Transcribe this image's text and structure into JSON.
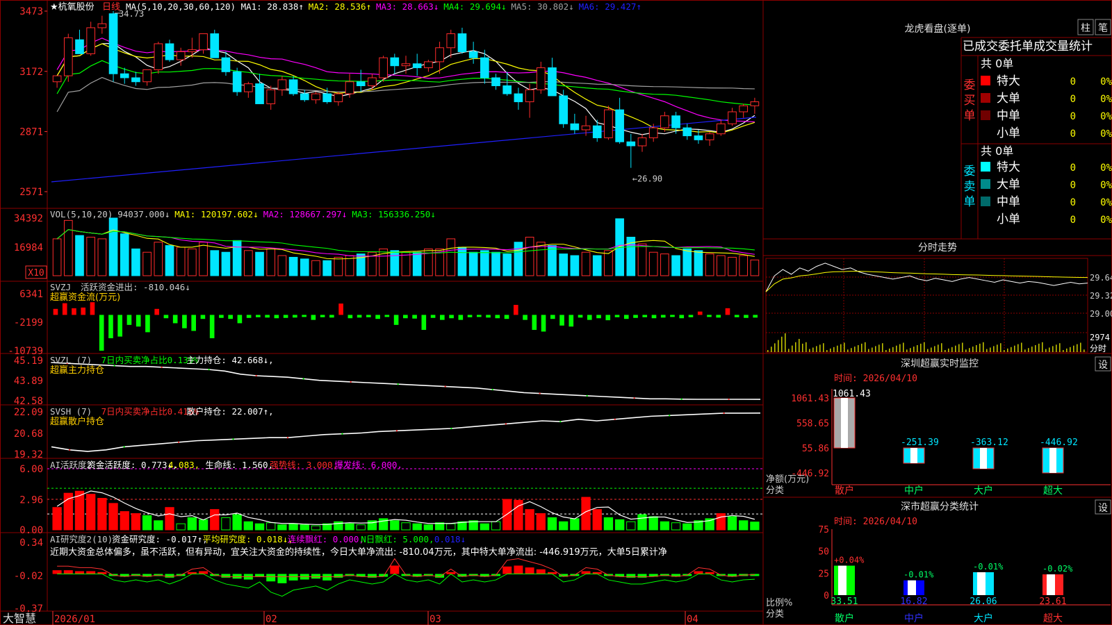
{
  "stock": {
    "title": "★杭氧股份",
    "period": "日线"
  },
  "colors": {
    "up": "#ff2b2b",
    "down": "#00e5ff",
    "grid": "#8b0000",
    "ma1": "#ffffff",
    "ma2": "#ffff00",
    "ma3": "#ff00ff",
    "ma4": "#00ff00",
    "ma5": "#a0a0a0",
    "ma6": "#2020ff"
  },
  "price_panel": {
    "legend": [
      {
        "text": "MA(5,10,20,30,60,120)",
        "color": "#ffffff"
      },
      {
        "text": "MA1: 28.838↑",
        "color": "#ffffff"
      },
      {
        "text": "MA2: 28.536↑",
        "color": "#ffff00"
      },
      {
        "text": "MA3: 28.663↓",
        "color": "#ff00ff"
      },
      {
        "text": "MA4: 29.694↓",
        "color": "#00ff00"
      },
      {
        "text": "MA5: 30.802↓",
        "color": "#a0a0a0"
      },
      {
        "text": "MA6: 29.427↑",
        "color": "#2020ff"
      }
    ],
    "y_ticks": [
      "3473",
      "3172",
      "2871",
      "2571"
    ],
    "high_label": "34.73",
    "low_label": "26.90"
  },
  "volume_panel": {
    "legend": [
      {
        "text": "VOL(5,10,20)",
        "color": "#cccccc"
      },
      {
        "text": "94037.000↓",
        "color": "#cccccc"
      },
      {
        "text": "MA1: 120197.602↓",
        "color": "#ffff00"
      },
      {
        "text": "MA2: 128667.297↓",
        "color": "#ff00ff"
      },
      {
        "text": "MA3: 156336.250↓",
        "color": "#00ff00"
      }
    ],
    "y_ticks": [
      "34392",
      "16984"
    ],
    "unit": "X10"
  },
  "svzj_panel": {
    "legend": [
      {
        "text": "SVZJ",
        "color": "#cccccc"
      },
      {
        "text": "活跃资金进出: -810.046↓",
        "color": "#cccccc"
      }
    ],
    "subtitle": "超赢资金流(万元)",
    "y_ticks": [
      "6341",
      "-2199",
      "-10739"
    ]
  },
  "svzl_panel": {
    "legend": [
      {
        "text": "SVZL (7)",
        "color": "#cccccc"
      },
      {
        "text": "7日内买卖净占比0.139%",
        "color": "#00ff00"
      },
      {
        "text": "主力持仓: 42.668↓,",
        "color": "#ffffff"
      }
    ],
    "subtitle": "超赢主力持仓",
    "y_ticks": [
      "45.19",
      "43.89",
      "42.58"
    ]
  },
  "svsh_panel": {
    "legend": [
      {
        "text": "SVSH (7)",
        "color": "#cccccc"
      },
      {
        "text": "7日内买卖净占比0.415%",
        "color": "#ff2b2b"
      },
      {
        "text": "散户持仓: 22.007↑,",
        "color": "#ffffff"
      }
    ],
    "subtitle": "超赢散户持仓",
    "y_ticks": [
      "22.09",
      "20.68",
      "19.32"
    ]
  },
  "ai_active_panel": {
    "legend": [
      {
        "text": "AI活跃度2",
        "color": "#cccccc"
      },
      {
        "text": "资金活跃度: 0.773↓,",
        "color": "#ffffff"
      },
      {
        "text": "4.083,",
        "color": "#ffff00"
      },
      {
        "text": "生命线: 1.560,",
        "color": "#ffffff"
      },
      {
        "text": "强势线: 3.000,",
        "color": "#ff2b2b"
      },
      {
        "text": "爆发线: 6.000,",
        "color": "#ff00ff"
      }
    ],
    "y_ticks": [
      "6.00",
      "2.96",
      "0.00"
    ]
  },
  "ai_research_panel": {
    "legend": [
      {
        "text": "AI研究度2(10)",
        "color": "#cccccc"
      },
      {
        "text": "资金研究度: -0.017↑,",
        "color": "#ffffff"
      },
      {
        "text": "平均研究度: 0.018↓,",
        "color": "#ffff00"
      },
      {
        "text": "连续飘红: 0.000,",
        "color": "#ff00ff"
      },
      {
        "text": "N日飘红: 5.000,",
        "color": "#00ff00"
      },
      {
        "text": "0.018↓",
        "color": "#2020ff"
      }
    ],
    "commentary": "近期大资金总体偏多，虽不活跃，但有异动，宜关注大资金的持续性，今日大单净流出: -810.04万元，其中特大单净流出: -446.919万元，大单5日累计净",
    "y_ticks": [
      "0.34",
      "-0.02",
      "-0.37"
    ]
  },
  "x_axis": {
    "brand": "大智慧",
    "labels": [
      "2026/01",
      "02",
      "03",
      "04"
    ]
  },
  "longhu": {
    "title": "龙虎看盘(逐单)",
    "btn_bar": "柱",
    "btn_pen": "笔",
    "header": "已成交委托单成交量统计",
    "buy_label": "委买单",
    "sell_label": "委卖单",
    "buy_total": "共 0单",
    "sell_total": "共 0单",
    "buy_rows": [
      {
        "name": "特大",
        "count": "0",
        "pct": "0%",
        "color": "#ff0000"
      },
      {
        "name": "大单",
        "count": "0",
        "pct": "0%",
        "color": "#a00000"
      },
      {
        "name": "中单",
        "count": "0",
        "pct": "0%",
        "color": "#700000"
      },
      {
        "name": "小单",
        "count": "0",
        "pct": "0%",
        "color": "#000000"
      }
    ],
    "sell_rows": [
      {
        "name": "特大",
        "count": "0",
        "pct": "0%",
        "color": "#00ffff"
      },
      {
        "name": "大单",
        "count": "0",
        "pct": "0%",
        "color": "#008b8b"
      },
      {
        "name": "中单",
        "count": "0",
        "pct": "0%",
        "color": "#006b6b"
      },
      {
        "name": "小单",
        "count": "0",
        "pct": "0%",
        "color": "#000000"
      }
    ]
  },
  "intraday": {
    "title": "分时走势",
    "y_ticks": [
      "29.64",
      "29.32",
      "29.00"
    ],
    "vol_label": "2974",
    "unit": "分时"
  },
  "monitor": {
    "title": "深圳超赢实时监控",
    "btn": "设",
    "time": "时间: 2026/04/10",
    "ylabel": "净额(万元)",
    "xlabel": "分类",
    "y_ticks": [
      "1061.43",
      "558.65",
      "55.86",
      "-446.92"
    ]
  },
  "classify": {
    "title": "深市超赢分类统计",
    "btn": "设",
    "time": "时间: 2026/04/10",
    "ylabel": "比例%",
    "xlabel": "分类",
    "y_ticks": [
      "75",
      "50",
      "25",
      "0"
    ]
  },
  "chart_data": [
    {
      "type": "candlestick",
      "title": "杭氧股份 日线",
      "ylim": [
        25.71,
        34.73
      ],
      "x": [
        "2026/01",
        "02",
        "03",
        "04"
      ],
      "ohlc": [
        [
          31.2,
          31.5,
          30.9,
          31.5
        ],
        [
          31.5,
          33.6,
          31.2,
          33.4
        ],
        [
          33.3,
          33.8,
          32.9,
          32.6
        ],
        [
          32.6,
          34.2,
          32.5,
          33.9
        ],
        [
          33.9,
          34.5,
          33.6,
          34.1
        ],
        [
          34.6,
          34.73,
          31.2,
          31.6
        ],
        [
          31.6,
          31.9,
          31.1,
          31.4
        ],
        [
          31.4,
          31.7,
          31.0,
          31.2
        ],
        [
          31.2,
          31.8,
          31.0,
          31.8
        ],
        [
          31.8,
          33.2,
          31.6,
          33.1
        ],
        [
          33.1,
          33.3,
          32.2,
          32.3
        ],
        [
          32.3,
          32.9,
          32.0,
          32.7
        ],
        [
          32.7,
          33.4,
          32.4,
          32.8
        ],
        [
          32.8,
          33.6,
          32.6,
          33.6
        ],
        [
          33.6,
          33.8,
          32.5,
          32.4
        ],
        [
          32.4,
          32.7,
          31.5,
          31.7
        ],
        [
          31.7,
          31.9,
          30.5,
          30.7
        ],
        [
          30.7,
          31.2,
          30.4,
          31.1
        ],
        [
          31.1,
          31.6,
          30.1,
          30.1
        ],
        [
          30.1,
          31.0,
          29.8,
          30.8
        ],
        [
          30.8,
          31.5,
          30.5,
          31.3
        ],
        [
          31.3,
          31.5,
          30.5,
          30.6
        ],
        [
          30.6,
          30.8,
          30.2,
          30.3
        ],
        [
          30.3,
          30.7,
          30.1,
          30.6
        ],
        [
          30.6,
          30.9,
          30.1,
          30.2
        ],
        [
          30.2,
          30.7,
          30.0,
          30.6
        ],
        [
          30.6,
          31.6,
          30.4,
          31.2
        ],
        [
          31.2,
          31.8,
          30.7,
          31.0
        ],
        [
          31.0,
          31.6,
          30.8,
          31.4
        ],
        [
          31.4,
          32.5,
          31.2,
          32.4
        ],
        [
          32.4,
          32.6,
          31.6,
          32.0
        ],
        [
          32.0,
          32.5,
          31.6,
          32.1
        ],
        [
          32.1,
          32.6,
          31.5,
          31.9
        ],
        [
          31.9,
          32.3,
          31.7,
          32.2
        ],
        [
          32.2,
          33.2,
          31.6,
          32.9
        ],
        [
          32.9,
          33.8,
          32.4,
          33.6
        ],
        [
          33.6,
          33.9,
          32.6,
          32.7
        ],
        [
          32.7,
          33.2,
          32.1,
          32.4
        ],
        [
          32.4,
          32.8,
          31.1,
          31.4
        ],
        [
          31.4,
          31.6,
          30.8,
          31.0
        ],
        [
          31.0,
          31.7,
          30.5,
          30.6
        ],
        [
          30.6,
          30.9,
          29.8,
          30.2
        ],
        [
          30.2,
          31.1,
          29.4,
          30.8
        ],
        [
          30.8,
          32.2,
          30.6,
          31.9
        ],
        [
          31.9,
          32.4,
          30.5,
          30.5
        ],
        [
          30.5,
          30.8,
          28.9,
          29.1
        ],
        [
          29.1,
          29.6,
          28.6,
          28.8
        ],
        [
          28.8,
          29.5,
          28.5,
          29.0
        ],
        [
          29.0,
          29.3,
          28.2,
          28.4
        ],
        [
          28.4,
          30.0,
          28.3,
          29.8
        ],
        [
          29.8,
          30.4,
          28.1,
          28.2
        ],
        [
          28.2,
          28.6,
          26.9,
          28.0
        ],
        [
          28.0,
          28.6,
          27.7,
          28.4
        ],
        [
          28.4,
          29.1,
          28.2,
          28.9
        ],
        [
          28.9,
          29.7,
          28.7,
          29.5
        ],
        [
          29.5,
          29.7,
          28.6,
          28.9
        ],
        [
          28.9,
          29.1,
          28.3,
          28.5
        ],
        [
          28.5,
          28.8,
          28.1,
          28.3
        ],
        [
          28.3,
          28.7,
          28.0,
          28.6
        ],
        [
          28.6,
          29.3,
          28.5,
          29.1
        ],
        [
          29.1,
          29.9,
          29.0,
          29.7
        ],
        [
          29.7,
          30.1,
          29.4,
          30.0
        ],
        [
          30.0,
          30.4,
          29.6,
          30.2
        ]
      ]
    },
    {
      "type": "bar",
      "title": "VOL(5,10,20)",
      "ylim": [
        0,
        34392
      ],
      "values": [
        22000,
        33000,
        24000,
        23000,
        22000,
        34392,
        25000,
        16000,
        14000,
        20000,
        18000,
        17000,
        16000,
        20000,
        15000,
        14000,
        21000,
        15000,
        14000,
        16000,
        12000,
        11000,
        10000,
        9000,
        9000,
        11000,
        12000,
        13000,
        14000,
        16000,
        15000,
        14000,
        14000,
        16000,
        16000,
        22000,
        17000,
        14000,
        15000,
        14000,
        13000,
        20000,
        23000,
        20000,
        18000,
        13000,
        12000,
        14000,
        12000,
        15000,
        34000,
        23000,
        19000,
        14000,
        13000,
        12000,
        16000,
        15000,
        13000,
        12000,
        11000,
        12000,
        9403
      ]
    },
    {
      "type": "bar",
      "title": "超赢资金流(万元)",
      "ylim": [
        -10739,
        6341
      ],
      "values": [
        1800,
        3500,
        2000,
        2200,
        3800,
        -10739,
        -7000,
        -6500,
        -3000,
        -3500,
        -5200,
        1800,
        -1000,
        -2500,
        -4000,
        -4800,
        -1200,
        -7000,
        -900,
        -1200,
        -2500,
        -900,
        -700,
        -800,
        -1000,
        -900,
        -800,
        -600,
        -1500,
        -700,
        -800,
        3400,
        -1000,
        -800,
        -700,
        -1200,
        -600,
        -3000,
        -1000,
        -1100,
        -4500,
        -900,
        -1500,
        -1000,
        -1500,
        -700,
        -500,
        -800,
        -1000,
        -1200,
        3000,
        -1500,
        -4500,
        -5000,
        -1200,
        -3200,
        -3500,
        -800,
        -1500,
        -1000,
        -1600,
        -700,
        -1200,
        -900,
        -700,
        -1000,
        -800,
        -600,
        -1000,
        -700,
        1000,
        -600,
        -800,
        2000,
        -700,
        -900,
        -810
      ]
    },
    {
      "type": "line",
      "title": "超赢主力持仓",
      "ylim": [
        42.58,
        45.19
      ],
      "values": [
        45.05,
        45.0,
        44.95,
        44.9,
        44.85,
        44.8,
        44.8,
        44.75,
        44.7,
        44.65,
        44.6,
        44.5,
        44.3,
        44.2,
        44.15,
        44.1,
        44.0,
        43.9,
        43.85,
        43.8,
        43.75,
        43.7,
        43.65,
        43.6,
        43.55,
        43.5,
        43.45,
        43.4,
        43.3,
        43.2,
        43.1,
        43.05,
        43.0,
        42.95,
        42.9,
        42.85,
        42.8,
        42.75,
        42.7,
        42.7,
        42.68,
        42.67,
        42.67,
        42.67,
        42.67,
        42.668
      ]
    },
    {
      "type": "line",
      "title": "超赢散户持仓",
      "ylim": [
        19.32,
        22.09
      ],
      "values": [
        19.8,
        19.6,
        19.5,
        19.6,
        19.8,
        19.9,
        20.0,
        20.1,
        20.2,
        20.25,
        20.3,
        20.35,
        20.4,
        20.4,
        20.5,
        20.6,
        20.65,
        20.7,
        20.8,
        20.85,
        20.9,
        20.95,
        21.0,
        21.1,
        21.2,
        21.3,
        21.4,
        21.5,
        21.45,
        21.6,
        21.5,
        21.6,
        21.7,
        21.8,
        21.85,
        21.9,
        21.95,
        22.0,
        22.0,
        22.007
      ]
    },
    {
      "type": "bar",
      "title": "AI活跃度2",
      "ylim": [
        0,
        6.0
      ],
      "values": [
        2.2,
        3.6,
        3.8,
        3.5,
        3.1,
        2.6,
        1.8,
        1.6,
        1.4,
        0.9,
        2.2,
        0.6,
        1.2,
        1.0,
        2.0,
        1.2,
        1.5,
        0.8,
        0.6,
        0.7,
        0.5,
        0.6,
        0.5,
        0.4,
        0.6,
        0.8,
        0.6,
        0.5,
        0.9,
        1.1,
        0.9,
        0.7,
        0.6,
        0.5,
        0.7,
        0.6,
        0.8,
        0.9,
        0.6,
        0.8,
        3.0,
        2.9,
        2.0,
        1.6,
        1.2,
        0.8,
        1.1,
        3.2,
        2.0,
        1.2,
        1.0,
        0.8,
        1.5,
        1.3,
        0.8,
        0.7,
        0.6,
        0.9,
        1.1,
        1.6,
        1.3,
        0.9,
        0.773
      ]
    },
    {
      "type": "bar",
      "title": "AI研究度2(10)",
      "ylim": [
        -0.37,
        0.34
      ],
      "values": [
        0.04,
        0.04,
        0.03,
        0.03,
        0.02,
        -0.02,
        -0.03,
        -0.02,
        -0.03,
        -0.02,
        -0.04,
        -0.02,
        0.02,
        0.03,
        -0.02,
        -0.04,
        -0.05,
        -0.06,
        -0.03,
        -0.08,
        -0.1,
        -0.07,
        -0.06,
        -0.05,
        -0.07,
        -0.04,
        -0.02,
        -0.03,
        -0.04,
        -0.03,
        0.09,
        -0.02,
        -0.03,
        -0.02,
        -0.04,
        0.02,
        -0.03,
        -0.02,
        -0.03,
        -0.02,
        0.08,
        0.09,
        0.07,
        0.05,
        0.02,
        -0.03,
        -0.02,
        0.03,
        0.02,
        -0.02,
        -0.03,
        -0.04,
        -0.04,
        -0.03,
        -0.02,
        -0.03,
        -0.02,
        0.03,
        0.02,
        -0.02,
        -0.03,
        -0.02,
        -0.017
      ]
    },
    {
      "type": "line",
      "title": "分时走势",
      "ylim": [
        28.85,
        29.72
      ],
      "values": [
        29.3,
        29.5,
        29.58,
        29.52,
        29.6,
        29.56,
        29.62,
        29.66,
        29.62,
        29.58,
        29.6,
        29.55,
        29.52,
        29.5,
        29.48,
        29.46,
        29.48,
        29.5,
        29.46,
        29.44,
        29.47,
        29.45,
        29.43,
        29.46,
        29.48,
        29.46,
        29.44,
        29.42,
        29.45,
        29.43,
        29.41,
        29.43,
        29.42,
        29.4,
        29.38,
        29.4,
        29.42,
        29.4,
        29.41
      ]
    },
    {
      "type": "bar",
      "title": "深圳超赢实时监控",
      "categories": [
        "散户",
        "中户",
        "大户",
        "超大"
      ],
      "values": [
        1061.43,
        -251.39,
        -363.12,
        -446.92
      ],
      "ylim": [
        -446.92,
        1061.43
      ]
    },
    {
      "type": "bar",
      "title": "深市超赢分类统计",
      "categories": [
        "散户",
        "中户",
        "大户",
        "超大"
      ],
      "values": [
        33.51,
        16.82,
        26.06,
        23.61
      ],
      "changes": [
        "+0.04%",
        "-0.01%",
        "-0.01%",
        "-0.02%"
      ],
      "ylim": [
        0,
        75
      ]
    }
  ]
}
